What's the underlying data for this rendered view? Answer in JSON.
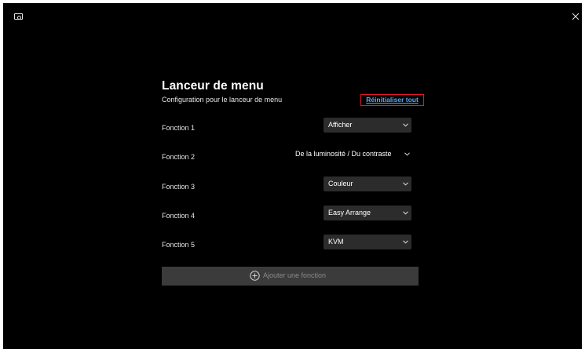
{
  "window": {
    "app_icon": "monitor-icon",
    "close_icon": "close-icon"
  },
  "header": {
    "title": "Lanceur de menu",
    "subtitle": "Configuration pour le lanceur de menu",
    "reset_label": "Réinitialiser tout"
  },
  "functions": [
    {
      "label": "Fonction 1",
      "value": "Afficher"
    },
    {
      "label": "Fonction 2",
      "value": "De la luminosité / Du contraste"
    },
    {
      "label": "Fonction 3",
      "value": "Couleur"
    },
    {
      "label": "Fonction 4",
      "value": "Easy Arrange"
    },
    {
      "label": "Fonction 5",
      "value": "KVM"
    }
  ],
  "add_button": {
    "label": "Ajouter une fonction",
    "icon": "plus-circle-icon"
  },
  "colors": {
    "background": "#000000",
    "link": "#5ea9f0",
    "focus_outline": "#e8142a",
    "dropdown_bg": "#2c2c2c",
    "button_bg": "#3b3b3b"
  }
}
